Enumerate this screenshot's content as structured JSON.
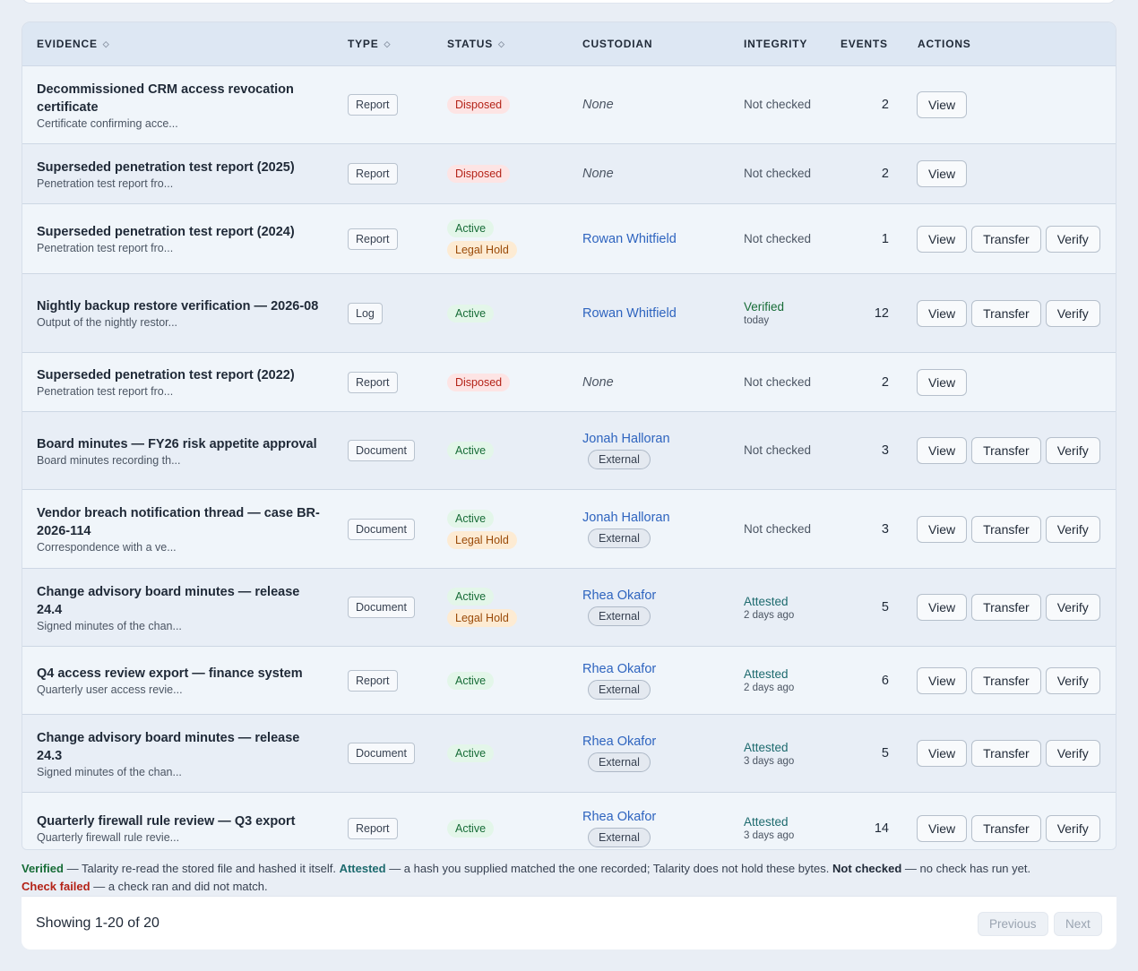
{
  "columns": {
    "evidence": "EVIDENCE",
    "type": "TYPE",
    "status": "STATUS",
    "custodian": "CUSTODIAN",
    "integrity": "INTEGRITY",
    "events": "EVENTS",
    "actions": "ACTIONS"
  },
  "sort_icon": "◇",
  "rows": [
    {
      "title": "Decommissioned CRM access revocation certificate",
      "desc": "Certificate confirming acce...",
      "type": "Report",
      "status": [
        "Disposed"
      ],
      "custodian": "None",
      "external": "",
      "integrity": "Not checked",
      "integrity_when": "",
      "events": "2",
      "actions": [
        "View"
      ]
    },
    {
      "title": "Superseded penetration test report (2025)",
      "desc": "Penetration test report fro...",
      "type": "Report",
      "status": [
        "Disposed"
      ],
      "custodian": "None",
      "external": "",
      "integrity": "Not checked",
      "integrity_when": "",
      "events": "2",
      "actions": [
        "View"
      ]
    },
    {
      "title": "Superseded penetration test report (2024)",
      "desc": "Penetration test report fro...",
      "type": "Report",
      "status": [
        "Active",
        "Legal Hold"
      ],
      "custodian": "Rowan Whitfield",
      "external": "",
      "integrity": "Not checked",
      "integrity_when": "",
      "events": "1",
      "actions": [
        "View",
        "Transfer",
        "Verify"
      ]
    },
    {
      "title": "Nightly backup restore verification — 2026-08",
      "desc": "Output of the nightly restor...",
      "type": "Log",
      "status": [
        "Active"
      ],
      "custodian": "Rowan Whitfield",
      "external": "",
      "integrity": "Verified",
      "integrity_when": "today",
      "events": "12",
      "actions": [
        "View",
        "Transfer",
        "Verify"
      ]
    },
    {
      "title": "Superseded penetration test report (2022)",
      "desc": "Penetration test report fro...",
      "type": "Report",
      "status": [
        "Disposed"
      ],
      "custodian": "None",
      "external": "",
      "integrity": "Not checked",
      "integrity_when": "",
      "events": "2",
      "actions": [
        "View"
      ]
    },
    {
      "title": "Board minutes — FY26 risk appetite approval",
      "desc": "Board minutes recording th...",
      "type": "Document",
      "status": [
        "Active"
      ],
      "custodian": "Jonah Halloran",
      "external": "External",
      "integrity": "Not checked",
      "integrity_when": "",
      "events": "3",
      "actions": [
        "View",
        "Transfer",
        "Verify"
      ]
    },
    {
      "title": "Vendor breach notification thread — case BR-2026-114",
      "desc": "Correspondence with a ve...",
      "type": "Document",
      "status": [
        "Active",
        "Legal Hold"
      ],
      "custodian": "Jonah Halloran",
      "external": "External",
      "integrity": "Not checked",
      "integrity_when": "",
      "events": "3",
      "actions": [
        "View",
        "Transfer",
        "Verify"
      ]
    },
    {
      "title": "Change advisory board minutes — release 24.4",
      "desc": "Signed minutes of the chan...",
      "type": "Document",
      "status": [
        "Active",
        "Legal Hold"
      ],
      "custodian": "Rhea Okafor",
      "external": "External",
      "integrity": "Attested",
      "integrity_when": "2 days ago",
      "events": "5",
      "actions": [
        "View",
        "Transfer",
        "Verify"
      ]
    },
    {
      "title": "Q4 access review export — finance system",
      "desc": "Quarterly user access revie...",
      "type": "Report",
      "status": [
        "Active"
      ],
      "custodian": "Rhea Okafor",
      "external": "External",
      "integrity": "Attested",
      "integrity_when": "2 days ago",
      "events": "6",
      "actions": [
        "View",
        "Transfer",
        "Verify"
      ]
    },
    {
      "title": "Change advisory board minutes — release 24.3",
      "desc": "Signed minutes of the chan...",
      "type": "Document",
      "status": [
        "Active"
      ],
      "custodian": "Rhea Okafor",
      "external": "External",
      "integrity": "Attested",
      "integrity_when": "3 days ago",
      "events": "5",
      "actions": [
        "View",
        "Transfer",
        "Verify"
      ]
    },
    {
      "title": "Quarterly firewall rule review — Q3 export",
      "desc": "Quarterly firewall rule revie...",
      "type": "Report",
      "status": [
        "Active"
      ],
      "custodian": "Rhea Okafor",
      "external": "External",
      "integrity": "Attested",
      "integrity_when": "3 days ago",
      "events": "14",
      "actions": [
        "View",
        "Transfer",
        "Verify"
      ]
    }
  ],
  "legend": {
    "verified_term": "Verified",
    "verified_text": " — Talarity re-read the stored file and hashed it itself. ",
    "attested_term": "Attested",
    "attested_text": " — a hash you supplied matched the one recorded; Talarity does not hold these bytes. ",
    "not_checked_term": "Not checked",
    "not_checked_text": " — no check has run yet.",
    "failed_term": "Check failed",
    "failed_text": " — a check ran and did not match."
  },
  "pagination": {
    "showing": "Showing 1-20 of 20",
    "previous": "Previous",
    "next": "Next"
  },
  "colors": {
    "disposed": "#b42318",
    "active": "#176c37",
    "legal_hold": "#9a4a08",
    "link": "#2e64bf",
    "attested": "#1d6a6e"
  }
}
